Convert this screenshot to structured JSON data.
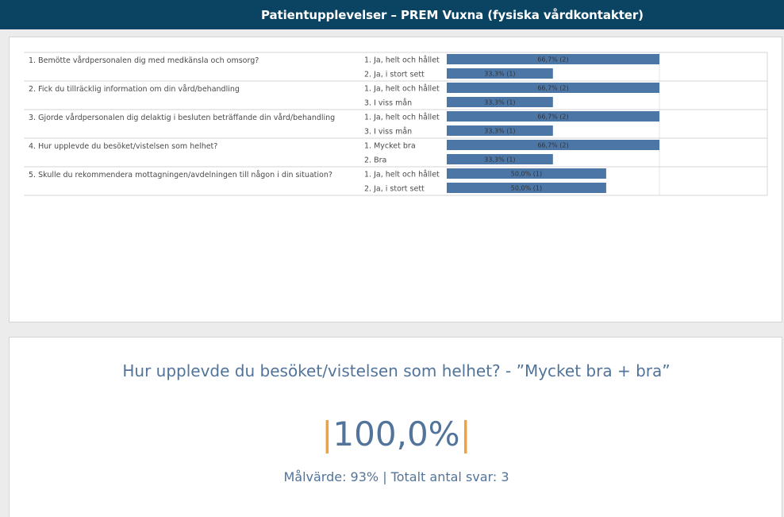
{
  "banner": {
    "title": "Patientupplevelser – PREM Vuxna (fysiska vårdkontakter)"
  },
  "chart_data": {
    "type": "bar",
    "orientation": "horizontal",
    "x_range": [
      0,
      100
    ],
    "bar_color": "#4c76a6",
    "questions": [
      {
        "question": "1. Bemötte vårdpersonalen dig med medkänsla och omsorg?",
        "answers": [
          {
            "answer": "1. Ja, helt och hållet",
            "value": 66.7,
            "label": "66,7% (2)"
          },
          {
            "answer": "2. Ja, i stort sett",
            "value": 33.3,
            "label": "33,3% (1)"
          }
        ]
      },
      {
        "question": "2. Fick du tillräcklig information om din vård/behandling",
        "answers": [
          {
            "answer": "1. Ja, helt och hållet",
            "value": 66.7,
            "label": "66,7% (2)"
          },
          {
            "answer": "3. I viss mån",
            "value": 33.3,
            "label": "33,3% (1)"
          }
        ]
      },
      {
        "question": "3. Gjorde vårdpersonalen dig delaktig i besluten beträffande din vård/behandling",
        "answers": [
          {
            "answer": "1. Ja, helt och hållet",
            "value": 66.7,
            "label": "66,7% (2)"
          },
          {
            "answer": "3. I viss mån",
            "value": 33.3,
            "label": "33,3% (1)"
          }
        ]
      },
      {
        "question": "4. Hur upplevde du besöket/vistelsen som helhet?",
        "answers": [
          {
            "answer": "1. Mycket bra",
            "value": 66.7,
            "label": "66,7% (2)"
          },
          {
            "answer": "2. Bra",
            "value": 33.3,
            "label": "33,3% (1)"
          }
        ]
      },
      {
        "question": "5. Skulle du rekommendera mottagningen/avdelningen till någon i din situation?",
        "answers": [
          {
            "answer": "1. Ja, helt och hållet",
            "value": 50.0,
            "label": "50,0% (1)"
          },
          {
            "answer": "2. Ja, i stort sett",
            "value": 50.0,
            "label": "50,0% (1)"
          }
        ]
      }
    ]
  },
  "kpi": {
    "question": "Hur upplevde du besöket/vistelsen som helhet? - ”Mycket bra + bra”",
    "value": "100,0%",
    "bar_left": "|",
    "bar_right": "|",
    "footer": "Målvärde: 93% | Totalt antal svar: 3",
    "accent_color": "#f0a03c",
    "text_color": "#52749a"
  }
}
